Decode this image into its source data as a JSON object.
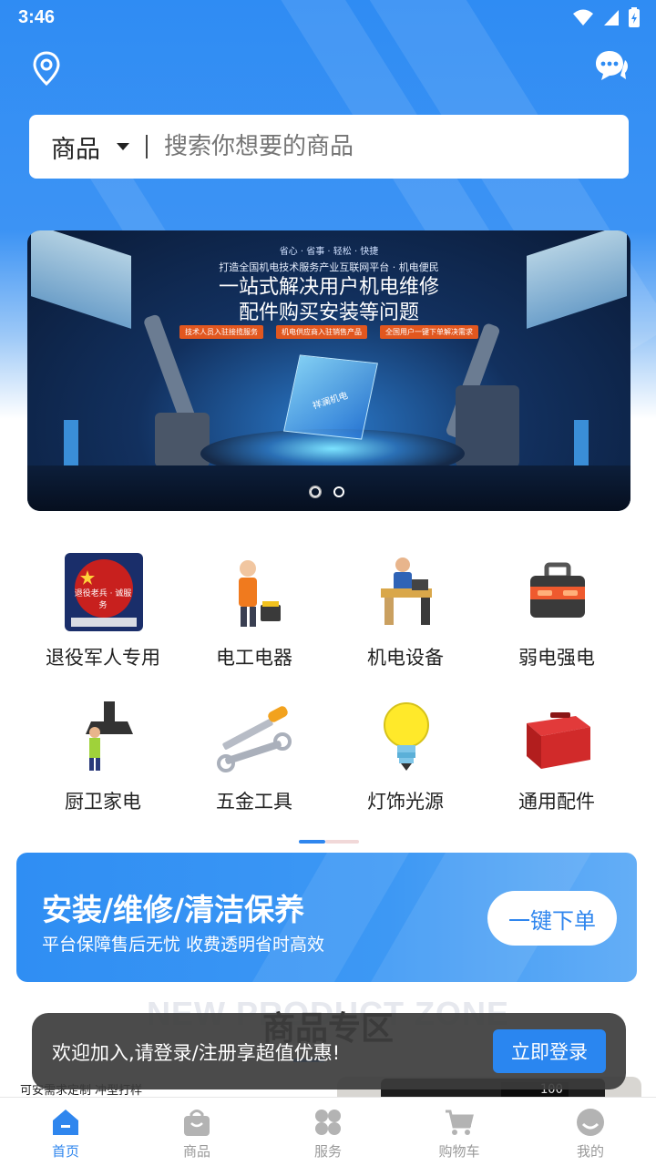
{
  "status_bar": {
    "time": "3:46"
  },
  "colors": {
    "accent": "#2f86ee",
    "toast_bg": "#3c3c3c",
    "tab_inactive": "#9a9a9a"
  },
  "search": {
    "category": "商品",
    "placeholder": "搜索你想要的商品"
  },
  "banner": {
    "tagline": "省心 · 省事 · 轻松 · 快捷",
    "line1": "打造全国机电技术服务产业互联网平台 · 机电便民",
    "title_line1": "一站式解决用户机电维修",
    "title_line2": "配件购买安装等问题",
    "pills": [
      "技术人员入驻接揽服务",
      "机电供应商入驻销售产品",
      "全国用户一键下单解决需求"
    ],
    "cube_text": "祥澜机电",
    "slides_total": 2,
    "active_slide": 1
  },
  "categories": [
    {
      "label": "退役军人专用",
      "icon": "veteran-badge-icon"
    },
    {
      "label": "电工电器",
      "icon": "electrician-icon"
    },
    {
      "label": "机电设备",
      "icon": "workstation-icon"
    },
    {
      "label": "弱电强电",
      "icon": "toolbox-icon"
    },
    {
      "label": "厨卫家电",
      "icon": "range-hood-icon"
    },
    {
      "label": "五金工具",
      "icon": "screwdriver-wrench-icon"
    },
    {
      "label": "灯饰光源",
      "icon": "light-bulb-icon"
    },
    {
      "label": "通用配件",
      "icon": "red-toolbox-icon"
    }
  ],
  "veteran_badge_text": "退役老兵 · 诚服务",
  "service_card": {
    "title": "安装/维修/清洁保养",
    "subtitle": "平台保障售后无忧  收费透明省时高效",
    "button": "一键下单"
  },
  "zone": {
    "title_en": "NEW PRODUCT ZONE",
    "title_cn": "商品专区"
  },
  "custom_text": "可安需求定制 冲型打样",
  "product_display": "100",
  "toast": {
    "message": "欢迎加入,请登录/注册享超值优惠!",
    "button": "立即登录"
  },
  "tabs": [
    {
      "label": "首页",
      "icon": "home-icon",
      "active": true
    },
    {
      "label": "商品",
      "icon": "shopping-bag-icon",
      "active": false
    },
    {
      "label": "服务",
      "icon": "services-grid-icon",
      "active": false
    },
    {
      "label": "购物车",
      "icon": "cart-icon",
      "active": false
    },
    {
      "label": "我的",
      "icon": "profile-icon",
      "active": false
    }
  ]
}
